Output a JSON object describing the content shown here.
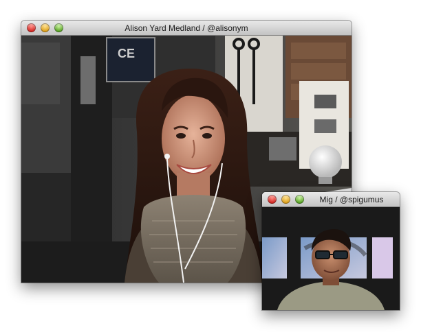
{
  "main_window": {
    "title": "Alison Yard Medland / @alisonym",
    "controls": [
      "close-button",
      "minimize-button",
      "zoom-button"
    ]
  },
  "preview_window": {
    "title": "Mig / @spigumus",
    "controls": [
      "close-button",
      "minimize-button",
      "zoom-button"
    ]
  },
  "colors": {
    "titlebar_top": "#e9e9e9",
    "titlebar_bottom": "#c3c3c3",
    "close": "#d0201b",
    "minimize": "#d99a12",
    "zoom": "#4f9c1b"
  }
}
